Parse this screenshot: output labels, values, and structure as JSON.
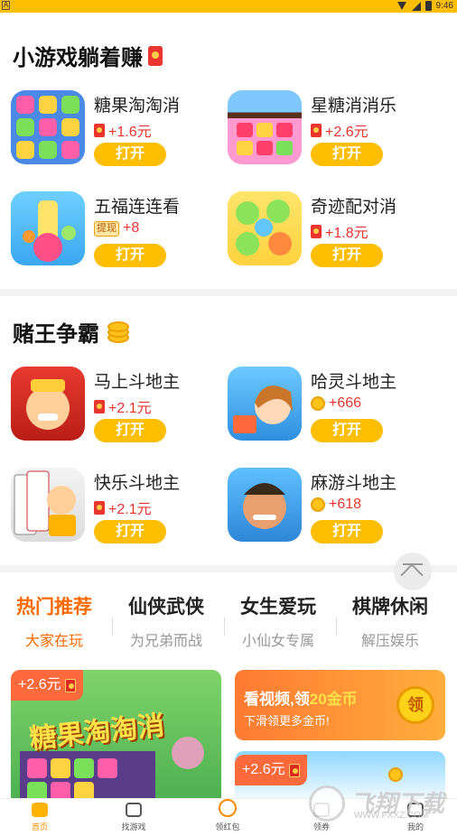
{
  "status_bar": {
    "time": "9:46",
    "app_letter": "A"
  },
  "sections": [
    {
      "title": "小游戏躺着赚",
      "games": [
        {
          "name": "糖果淘淘消",
          "reward": "+1.6元",
          "reward_type": "redpack",
          "button": "打开"
        },
        {
          "name": "星糖消消乐",
          "reward": "+2.6元",
          "reward_type": "redpack",
          "button": "打开"
        },
        {
          "name": "五福连连看",
          "reward": "+8",
          "reward_type": "tixian",
          "reward_tag": "提现",
          "button": "打开"
        },
        {
          "name": "奇迹配对消",
          "reward": "+1.8元",
          "reward_type": "redpack",
          "button": "打开"
        }
      ]
    },
    {
      "title": "赌王争霸",
      "games": [
        {
          "name": "马上斗地主",
          "reward": "+2.1元",
          "reward_type": "redpack",
          "button": "打开"
        },
        {
          "name": "哈灵斗地主",
          "reward": "+666",
          "reward_type": "coin",
          "button": "打开"
        },
        {
          "name": "快乐斗地主",
          "reward": "+2.1元",
          "reward_type": "redpack",
          "button": "打开"
        },
        {
          "name": "麻游斗地主",
          "reward": "+618",
          "reward_type": "coin",
          "button": "打开"
        }
      ]
    }
  ],
  "tabs": [
    {
      "title": "热门推荐",
      "subtitle": "大家在玩"
    },
    {
      "title": "仙侠武侠",
      "subtitle": "为兄弟而战"
    },
    {
      "title": "女生爱玩",
      "subtitle": "小仙女专属"
    },
    {
      "title": "棋牌休闲",
      "subtitle": "解压娱乐"
    }
  ],
  "banner_left": {
    "badge": "+2.6元",
    "title": "糖果淘淘消"
  },
  "video_card": {
    "line1_prefix": "看视频,领",
    "line1_gold": "20金币",
    "line2": "下滑领更多金币!",
    "button": "领"
  },
  "card2": {
    "badge": "+2.6元"
  },
  "watermark": {
    "text": "飞翔下载",
    "url": "WWW.FXXZ.COM"
  },
  "bottom_nav": [
    {
      "label": "首页"
    },
    {
      "label": "找游戏"
    },
    {
      "label": "领红包"
    },
    {
      "label": "领券"
    },
    {
      "label": "我的"
    }
  ],
  "colors": {
    "accent": "#ffbf00",
    "active_tab": "#ff6a00",
    "reward_red": "#e8352e"
  }
}
